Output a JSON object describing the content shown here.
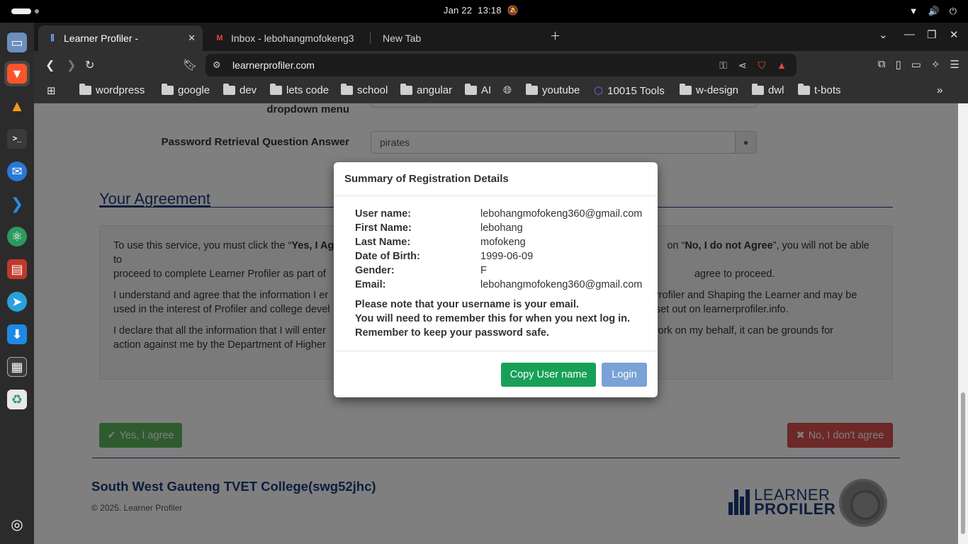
{
  "system": {
    "date": "Jan 22",
    "time": "13:18"
  },
  "tabs": [
    {
      "label": "Learner Profiler -",
      "active": true
    },
    {
      "label": "Inbox - lebohangmofokeng3"
    },
    {
      "label": "New Tab"
    }
  ],
  "omnibox": {
    "url": "learnerprofiler.com",
    "shield_count": "1"
  },
  "bookmarks": [
    "wordpress",
    "google",
    "dev",
    "lets code",
    "school",
    "angular",
    "AI",
    "youtube",
    "10015 Tools",
    "w-design",
    "dwl",
    "t-bots"
  ],
  "form": {
    "partial_label": "dropdown menu",
    "answer_label": "Password Retrieval Question Answer",
    "answer_value": "pirates"
  },
  "agreement": {
    "title": "Your Agreement",
    "p1a": "To use this service, you must click the “",
    "p1b": "Yes, I Ag",
    "p1c": "on “",
    "p1d": "No, I do not Agree",
    "p1e": "”, you will not be able to",
    "p1f": "proceed to complete Learner Profiler as part of",
    "p1g": "agree to proceed.",
    "p2a": "I understand and agree that the information I er",
    "p2b": "er Profiler and Shaping the Learner and may be",
    "p2c": "used in the interest of Profiler and college devel",
    "p2d": "ns set out on learnerprofiler.info.",
    "p3a": "I declare that all the information that I will enter",
    "p3b": "e to work on my behalf, it can be grounds for",
    "p3c": "action against me by the Department of Higher",
    "yes_label": "Yes, I agree",
    "no_label": "No, I don't agree"
  },
  "footer": {
    "college": "South West Gauteng TVET College(swg52jhc)",
    "copyright": "© 2025. Learner Profiler",
    "logo_line1": "LEARNER",
    "logo_line2": "PROFILER"
  },
  "modal": {
    "title": "Summary of Registration Details",
    "fields": [
      {
        "label": "User name:",
        "value": "lebohangmofokeng360@gmail.com"
      },
      {
        "label": "First Name:",
        "value": "lebohang"
      },
      {
        "label": "Last Name:",
        "value": "mofokeng"
      },
      {
        "label": "Date of Birth:",
        "value": "1999-06-09"
      },
      {
        "label": "Gender:",
        "value": "F"
      },
      {
        "label": "Email:",
        "value": "lebohangmofokeng360@gmail.com"
      }
    ],
    "note1": "Please note that your username is your email.",
    "note2": "You will need to remember this for when you next log in.",
    "note3": "Remember to keep your password safe.",
    "copy_label": "Copy User name",
    "login_label": "Login"
  },
  "colors": {
    "accent_green": "#18a058",
    "login_blue": "#7aa2d6",
    "brand_navy": "#1b3a7a",
    "danger": "#d9534f"
  }
}
